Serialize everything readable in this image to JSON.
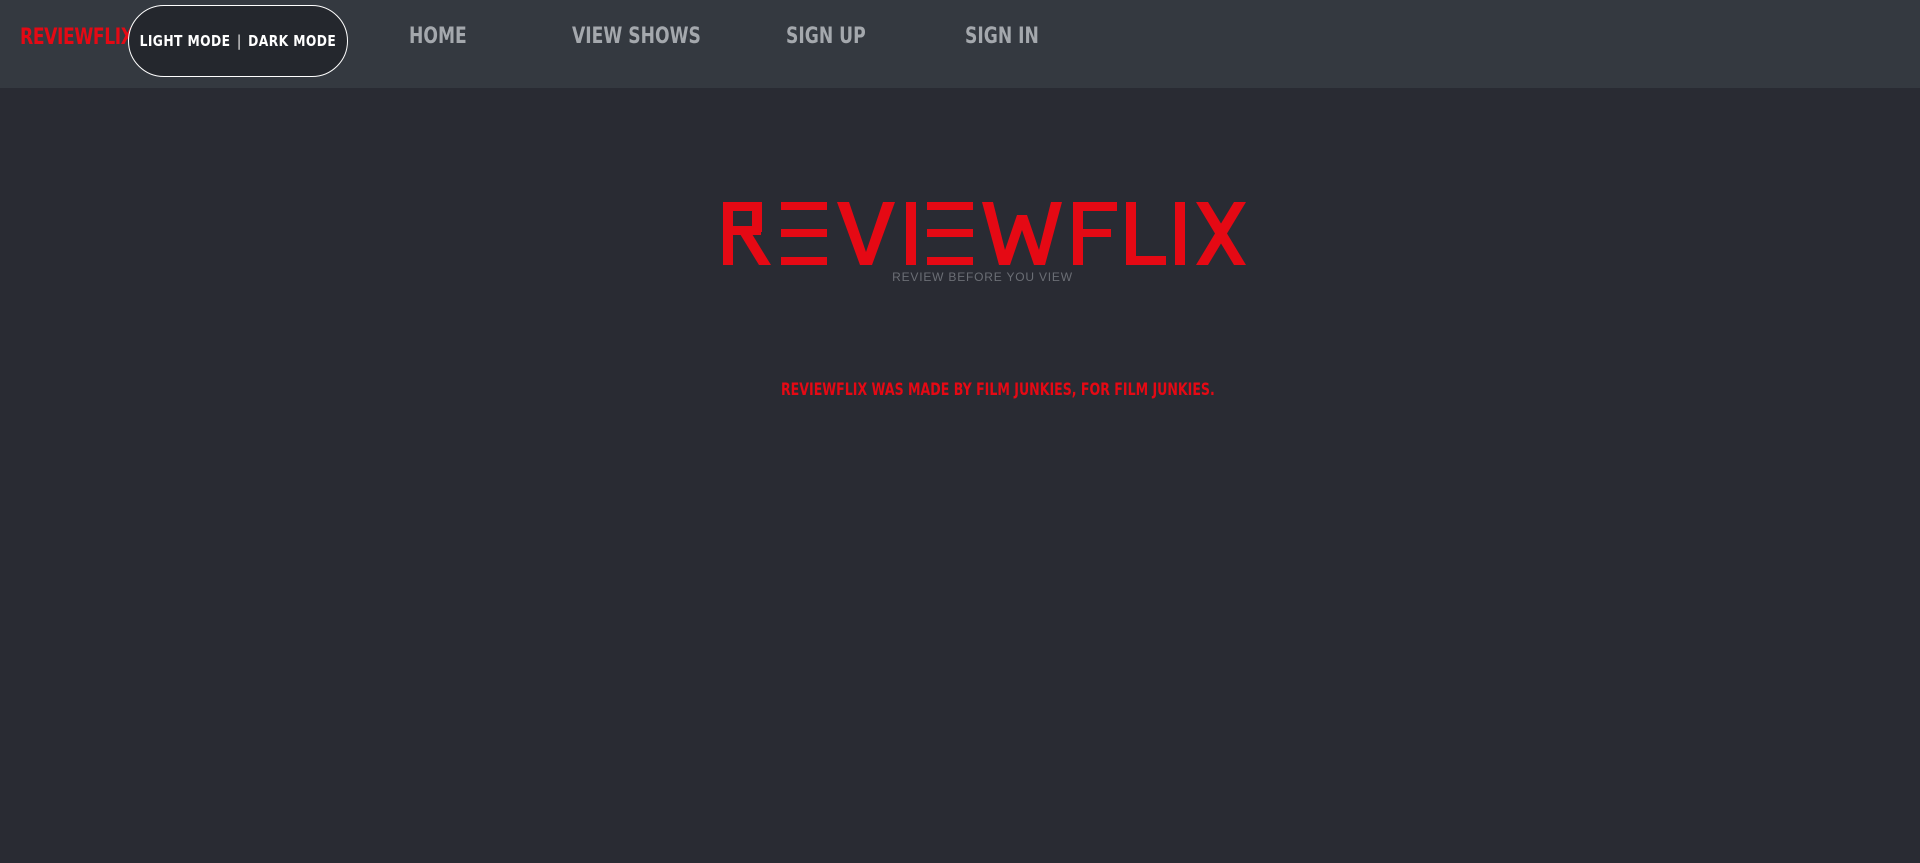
{
  "navbar": {
    "brand": "REVIEWFLIX",
    "mode_toggle": {
      "light_label": "LIGHT MODE",
      "separator": "|",
      "dark_label": "DARK MODE"
    },
    "links": [
      {
        "label": "HOME"
      },
      {
        "label": "VIEW SHOWS"
      },
      {
        "label": "SIGN UP"
      },
      {
        "label": "SIGN IN"
      }
    ]
  },
  "hero": {
    "logo_text": "REVIEWFLIX",
    "tagline": "REVIEW BEFORE YOU VIEW"
  },
  "about": {
    "text": "REVIEWFLIX WAS MADE BY FILM JUNKIES, FOR FILM JUNKIES."
  },
  "colors": {
    "brand_red": "#e50914",
    "page_background": "#292b33",
    "navbar_background": "#343940",
    "nav_link": "#a4a8ad",
    "tagline": "#6b6e75"
  }
}
